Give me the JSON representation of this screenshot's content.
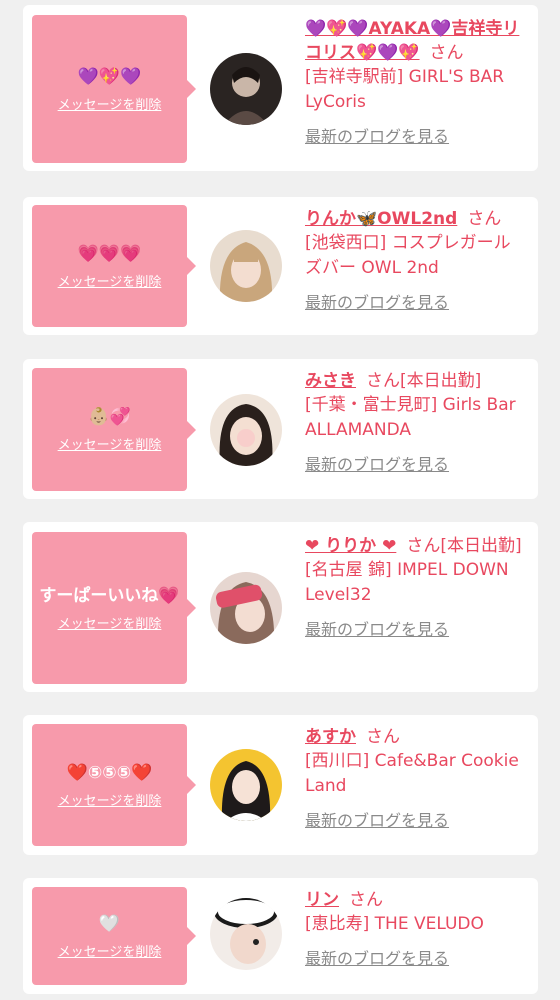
{
  "cards": [
    {
      "message": "💜💖💜",
      "delete_label": "メッセージを削除",
      "name": "💜💖💜AYAKA💜吉祥寺リコリス💖💜💖",
      "san": "さん",
      "status": "",
      "shop": "[吉祥寺駅前] GIRL'S BAR LyCoris",
      "blog_link": "最新のブログを見る"
    },
    {
      "message": "💗💗💗",
      "delete_label": "メッセージを削除",
      "name": "りんか🦋OWL2nd",
      "san": "さん",
      "status": "",
      "shop": "[池袋西口] コスプレガールズバー OWL 2nd",
      "blog_link": "最新のブログを見る"
    },
    {
      "message": "👶🏼💞",
      "delete_label": "メッセージを削除",
      "name": "みさき",
      "san": "さん",
      "status": "[本日出勤]",
      "shop": "[千葉・富士見町] Girls Bar ALLAMANDA",
      "blog_link": "最新のブログを見る"
    },
    {
      "message": "すーぱーいいね💗",
      "delete_label": "メッセージを削除",
      "name": "❤ りりか ❤",
      "san": "さん",
      "status": "[本日出勤]",
      "shop": "[名古屋 錦] IMPEL DOWN Level32",
      "blog_link": "最新のブログを見る"
    },
    {
      "message": "❤️⑤⑤⑤❤️",
      "delete_label": "メッセージを削除",
      "name": "あすか",
      "san": "さん",
      "status": "",
      "shop": "[西川口] Cafe&Bar Cookie Land",
      "blog_link": "最新のブログを見る"
    },
    {
      "message": "🤍",
      "delete_label": "メッセージを削除",
      "name": "リン",
      "san": "さん",
      "status": "",
      "shop": "[恵比寿] THE VELUDO",
      "blog_link": "最新のブログを見る"
    }
  ],
  "colors": {
    "accent": "#e8485f",
    "bubble": "#f79aab",
    "card_bg": "#ffffff",
    "page_bg": "#f0f0f0",
    "link_gray": "#8a8a8a"
  }
}
